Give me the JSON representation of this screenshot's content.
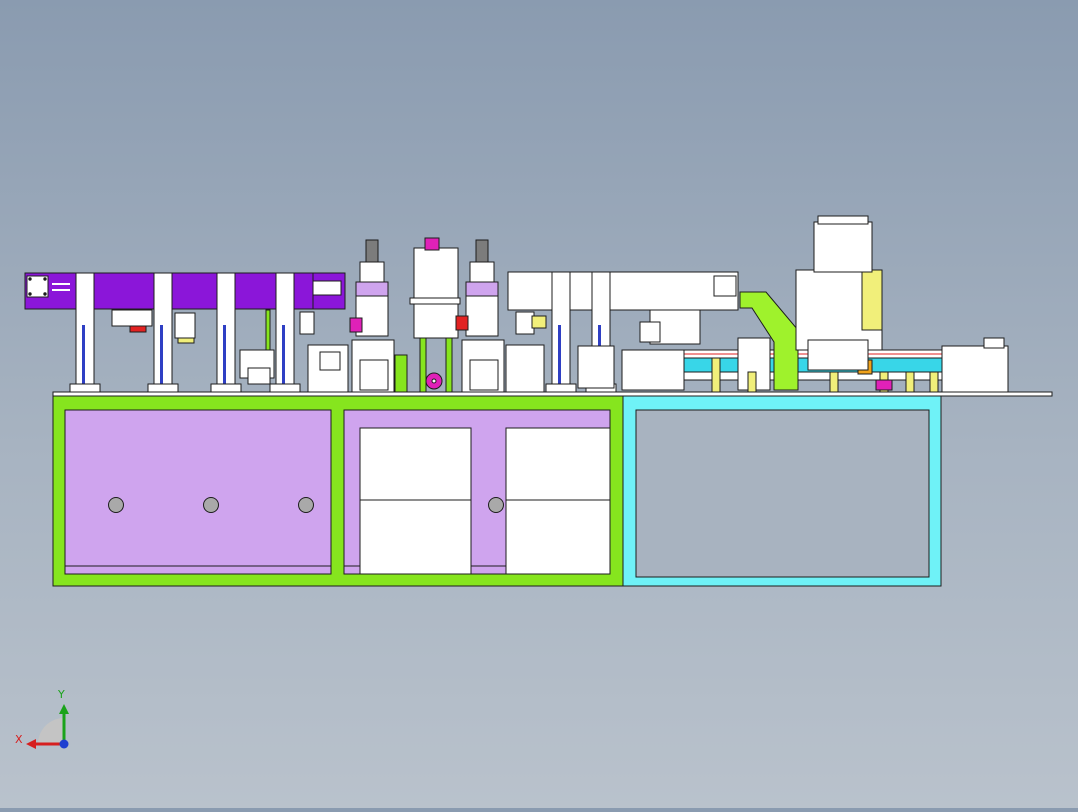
{
  "viewport": {
    "background_top": "#8a9bb0",
    "background_bottom": "#b9c2cc"
  },
  "colors": {
    "frame_green": "#86e51e",
    "panel_violet": "#cfa4ee",
    "beam_purple": "#8b16d9",
    "frame_cyan": "#6ff2f7",
    "conveyor_cyan": "#38d6e8",
    "chute_lime": "#9ff22c",
    "post_blue": "#2f3fc4",
    "accent_magenta": "#e021b8",
    "accent_orange": "#f0a21b",
    "accent_red": "#e22222",
    "bracket_yellow": "#f1ef7a",
    "outline": "#1d1d1d"
  },
  "triad": {
    "x_label": "X",
    "y_label": "Y",
    "x_color": "#d61f1f",
    "y_color": "#1aa31a",
    "z_color": "#1f3fd0"
  }
}
